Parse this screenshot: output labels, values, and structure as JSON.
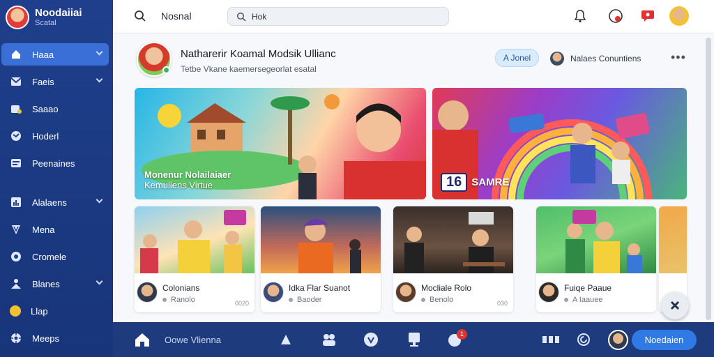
{
  "app": {
    "title": "Noodaiiai",
    "subtitle": "Scatal"
  },
  "sidebar": {
    "items": [
      {
        "label": "Haaa",
        "icon": "home-icon"
      },
      {
        "label": "Faeis",
        "icon": "mail-icon"
      },
      {
        "label": "Saaao",
        "icon": "shop-icon"
      },
      {
        "label": "Hoderl",
        "icon": "globe-icon"
      },
      {
        "label": "Peenaines",
        "icon": "card-icon"
      },
      {
        "label": "Alalaens",
        "icon": "chart-icon"
      },
      {
        "label": "Mena",
        "icon": "shield-icon"
      },
      {
        "label": "Cromele",
        "icon": "settings-icon"
      },
      {
        "label": "Blanes",
        "icon": "people-icon"
      },
      {
        "label": "Llap",
        "icon": "circle-icon"
      },
      {
        "label": "Meeps",
        "icon": "gear-icon"
      }
    ]
  },
  "topbar": {
    "title": "Nosnal",
    "search_value": "Hok"
  },
  "post": {
    "title": "Natharerir Koamal Modsik Ullianc",
    "subtitle": "Tetbe Vkane kaemersegeorlat esatal",
    "join_label": "A Jonel",
    "community_label": "Nalaes Conuntiens",
    "more": "•••"
  },
  "banners": [
    {
      "line1": "Monenur Nolailaiaer",
      "line2": "Kemuliens Virtue"
    },
    {
      "num": "16",
      "text": "SAMRE"
    }
  ],
  "cards": [
    {
      "title": "Colonians",
      "sub": "Ranolo",
      "meta": "0020"
    },
    {
      "title": "Idka Flar Suanot",
      "sub": "Baoder",
      "meta": ""
    },
    {
      "title": "Mocliale Rolo",
      "sub": "Benolo",
      "meta": "030"
    },
    {
      "title": "Fuiqe Paaue",
      "sub": "A Iaauee",
      "meta": ""
    }
  ],
  "bottombar": {
    "label": "Oowe Vlienna",
    "badge": "1",
    "button": "Noedaien"
  }
}
